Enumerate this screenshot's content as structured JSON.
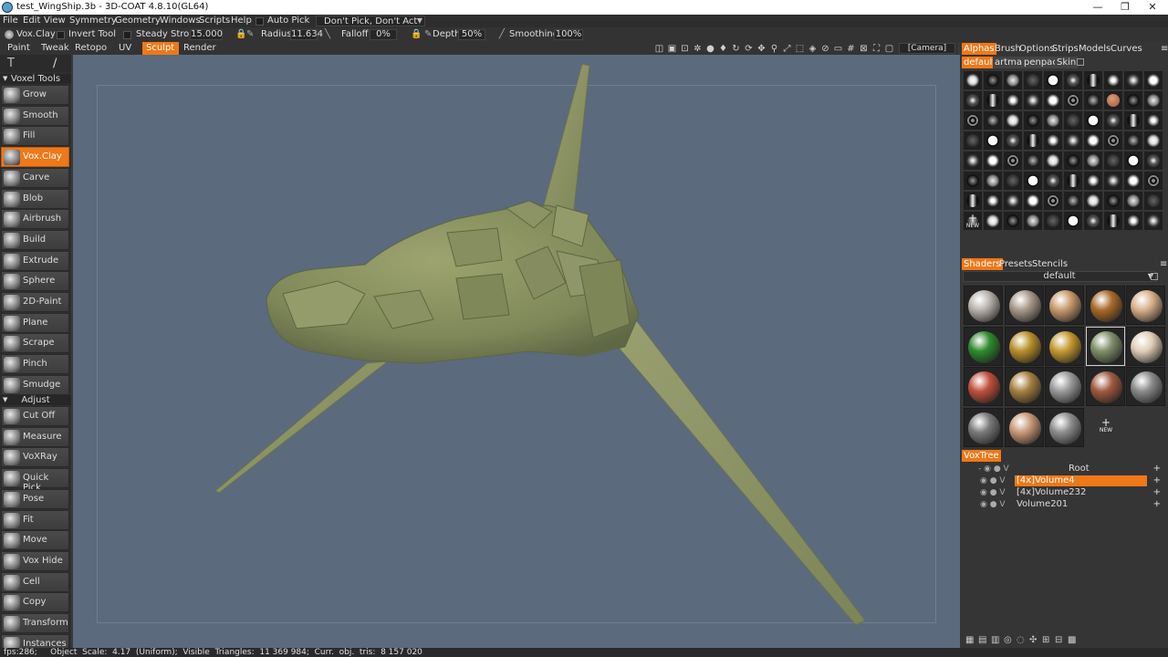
{
  "window": {
    "title": "test_WingShip.3b - 3D-COAT 4.8.10(GL64)",
    "minimize": "—",
    "maximize": "❐",
    "close": "✕"
  },
  "menu": [
    "File",
    "Edit",
    "View",
    "Symmetry",
    "Geometry",
    "Windows",
    "Scripts",
    "Help"
  ],
  "auto_pick": "Auto Pick",
  "pick_dropdown": "Don't Pick, Don't Act",
  "toolbar": {
    "tool_name": "Vox.Clay",
    "invert_tool": "Invert Tool",
    "steady_stroke_label": "Steady Stroke",
    "steady_stroke_value": "15.000",
    "radius_label": "Radius",
    "radius_value": "11.634",
    "falloff_label": "Falloff",
    "falloff_value": "0%",
    "depth_label": "Depth",
    "depth_value": "50%",
    "smoothing_label": "Smoothing",
    "smoothing_value": "100%"
  },
  "modes": [
    "Paint",
    "Tweak",
    "Retopo",
    "UV",
    "Sculpt",
    "Render"
  ],
  "active_mode": "Sculpt",
  "camera": "[Camera]",
  "voxel_tools_header": "Voxel Tools",
  "voxel_tools": [
    "Grow",
    "Smooth",
    "Fill",
    "Vox.Clay",
    "Carve",
    "Blob",
    "Airbrush",
    "Build",
    "Extrude",
    "Sphere",
    "2D-Paint",
    "Plane",
    "Scrape",
    "Pinch",
    "Smudge"
  ],
  "active_tool": "Vox.Clay",
  "adjust_header": "Adjust",
  "adjust_tools": [
    "Cut Off",
    "Measure",
    "VoXRay",
    "Quick Pick",
    "Pose",
    "Fit",
    "Move",
    "Vox Hide",
    "Cell",
    "Copy",
    "Transform",
    "Instances"
  ],
  "right_tabs": [
    "Alphas",
    "Brush",
    "Options",
    "Strips",
    "Models",
    "Curves"
  ],
  "alpha_subtabs": [
    "default",
    "artman",
    "penpack",
    "Skin"
  ],
  "alpha_new": "NEW",
  "shader_tabs": [
    "Shaders",
    "Presets",
    "Stencils"
  ],
  "shader_preset": "default",
  "shader_new": "NEW",
  "shader_colors": [
    "#b9b2ab",
    "#a8988a",
    "#c79a6e",
    "#a86a2a",
    "#d8b08c",
    "#2f8a2f",
    "#b8902a",
    "#c49a30",
    "#7f8f6a",
    "#e0cdb8",
    "#c0503c",
    "#a58040",
    "#9a9a9a",
    "#a05a40",
    "#8a8a8a",
    "#7a7a7a",
    "#c89878",
    "#8d8d8d"
  ],
  "voxtree": {
    "tab": "VoxTree",
    "root": "Root",
    "items": [
      "[4x]Volume4",
      "[4x]Volume232",
      "Volume201"
    ],
    "active_item": "[4x]Volume4"
  },
  "status": "fps:286;     Object  Scale:  4.17  (Uniform);  Visible  Triangles:  11 369 984;  Curr.  obj.  tris:  8 157 020",
  "colors": {
    "accent": "#ef7818",
    "viewport": "#5b6a7d",
    "model": "#8a9462"
  }
}
